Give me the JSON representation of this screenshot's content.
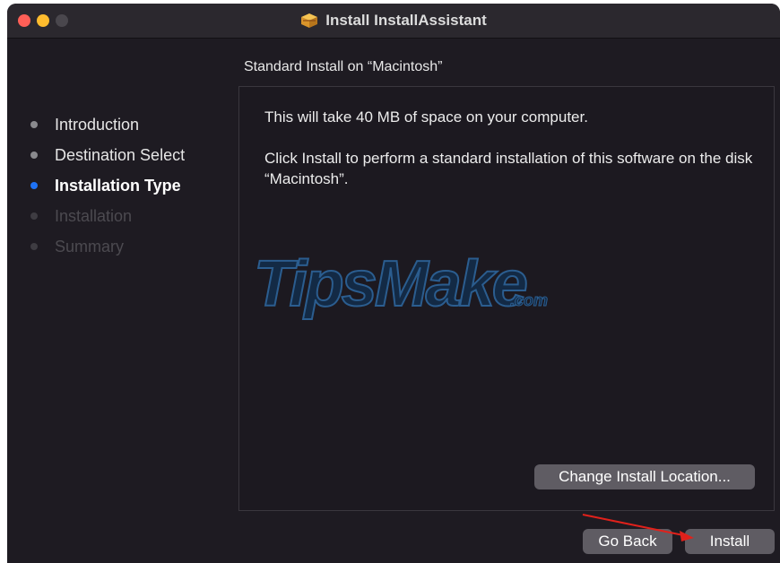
{
  "window": {
    "title": "Install InstallAssistant",
    "title_icon": "package-icon"
  },
  "sidebar": {
    "steps": [
      {
        "label": "Introduction",
        "state": "done"
      },
      {
        "label": "Destination Select",
        "state": "done"
      },
      {
        "label": "Installation Type",
        "state": "active"
      },
      {
        "label": "Installation",
        "state": "pending"
      },
      {
        "label": "Summary",
        "state": "pending"
      }
    ]
  },
  "main": {
    "header": "Standard Install on “Macintosh”",
    "space_text": "This will take 40 MB of space on your computer.",
    "install_text": "Click Install to perform a standard installation of this software on the disk “Macintosh”.",
    "change_location_label": "Change Install Location..."
  },
  "footer": {
    "go_back_label": "Go Back",
    "install_label": "Install"
  },
  "watermark": {
    "text": "TipsMake",
    "suffix": ".com"
  },
  "colors": {
    "active_dot": "#1e72f5",
    "close": "#ff5f57",
    "minimize": "#febc2e",
    "annotation_arrow": "#e0211b"
  }
}
